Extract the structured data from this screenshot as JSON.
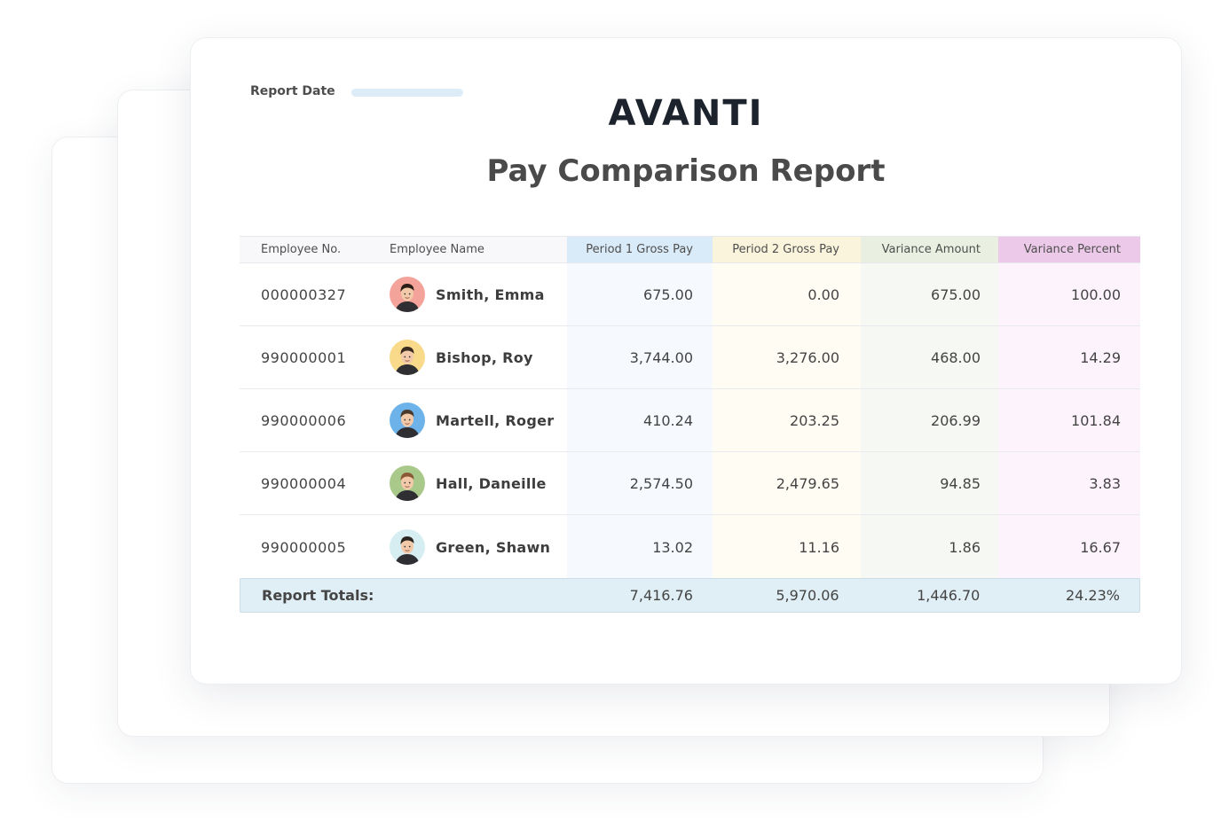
{
  "report": {
    "date_label": "Report Date",
    "brand": "AVANTI",
    "title": "Pay Comparison Report"
  },
  "table": {
    "headers": {
      "employee_no": "Employee No.",
      "employee_name": "Employee Name",
      "period1": "Period 1 Gross Pay",
      "period2": "Period 2 Gross Pay",
      "variance_amount": "Variance Amount",
      "variance_percent": "Variance Percent"
    },
    "rows": [
      {
        "no": "000000327",
        "name": "Smith, Emma",
        "p1": "675.00",
        "p2": "0.00",
        "var": "675.00",
        "pct": "100.00",
        "avatar_bg": "#f4a39a"
      },
      {
        "no": "990000001",
        "name": "Bishop, Roy",
        "p1": "3,744.00",
        "p2": "3,276.00",
        "var": "468.00",
        "pct": "14.29",
        "avatar_bg": "#f9d98a"
      },
      {
        "no": "990000006",
        "name": "Martell, Roger",
        "p1": "410.24",
        "p2": "203.25",
        "var": "206.99",
        "pct": "101.84",
        "avatar_bg": "#6db3ea"
      },
      {
        "no": "990000004",
        "name": "Hall, Daneille",
        "p1": "2,574.50",
        "p2": "2,479.65",
        "var": "94.85",
        "pct": "3.83",
        "avatar_bg": "#a9c98a"
      },
      {
        "no": "990000005",
        "name": "Green, Shawn",
        "p1": "13.02",
        "p2": "11.16",
        "var": "1.86",
        "pct": "16.67",
        "avatar_bg": "#d6eef2"
      }
    ],
    "totals": {
      "label": "Report Totals:",
      "p1": "7,416.76",
      "p2": "5,970.06",
      "var": "1,446.70",
      "pct": "24.23%"
    }
  },
  "colors": {
    "period1_header": "#d9ebf8",
    "period2_header": "#fbf4dd",
    "variance_amount_header": "#e9f0e1",
    "variance_percent_header": "#ecc9e9",
    "totals_bg": "#e0eff6"
  },
  "icons": [
    "avatar-emma-icon",
    "avatar-roy-icon",
    "avatar-roger-icon",
    "avatar-daneille-icon",
    "avatar-shawn-icon"
  ]
}
